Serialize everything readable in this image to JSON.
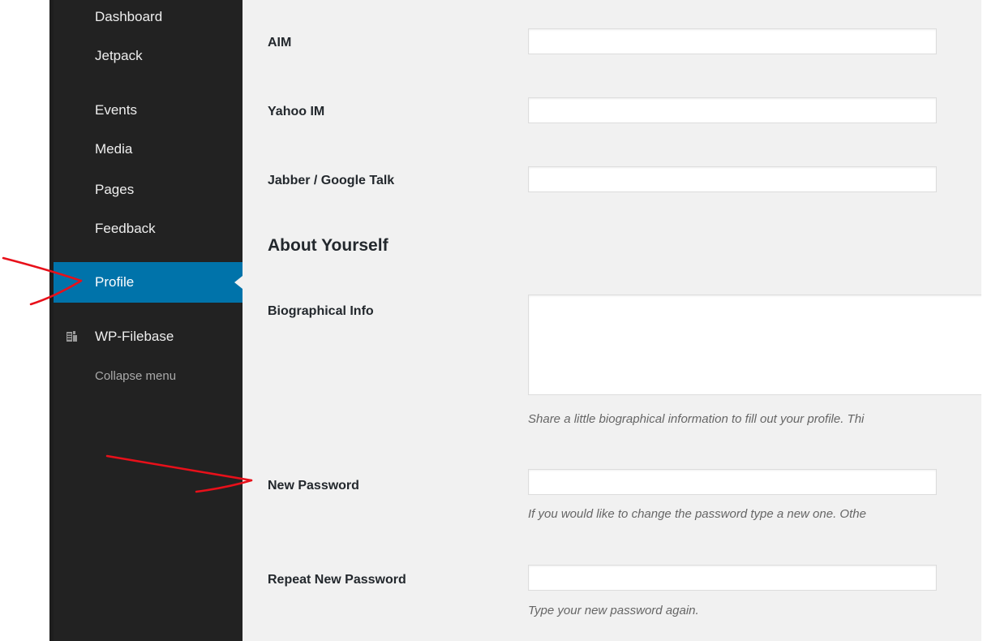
{
  "sidebar": {
    "items": [
      {
        "label": "Dashboard"
      },
      {
        "label": "Jetpack"
      },
      {
        "label": "Events"
      },
      {
        "label": "Media"
      },
      {
        "label": "Pages"
      },
      {
        "label": "Feedback"
      },
      {
        "label": "Profile",
        "current": true
      },
      {
        "label": "WP-Filebase",
        "icon": "filebase-icon"
      }
    ],
    "collapse_label": "Collapse menu"
  },
  "form": {
    "aim": {
      "label": "AIM",
      "value": ""
    },
    "yahoo": {
      "label": "Yahoo IM",
      "value": ""
    },
    "jabber": {
      "label": "Jabber / Google Talk",
      "value": ""
    },
    "about_heading": "About Yourself",
    "bio": {
      "label": "Biographical Info",
      "value": "",
      "description": "Share a little biographical information to fill out your profile. Thi"
    },
    "new_password": {
      "label": "New Password",
      "value": "",
      "description": "If you would like to change the password type a new one. Othe"
    },
    "repeat_password": {
      "label": "Repeat New Password",
      "value": "",
      "description": "Type your new password again."
    }
  },
  "colors": {
    "sidebar_bg": "#222222",
    "current_bg": "#0073aa",
    "content_bg": "#f1f1f1",
    "annotation_red": "#e8101a"
  }
}
